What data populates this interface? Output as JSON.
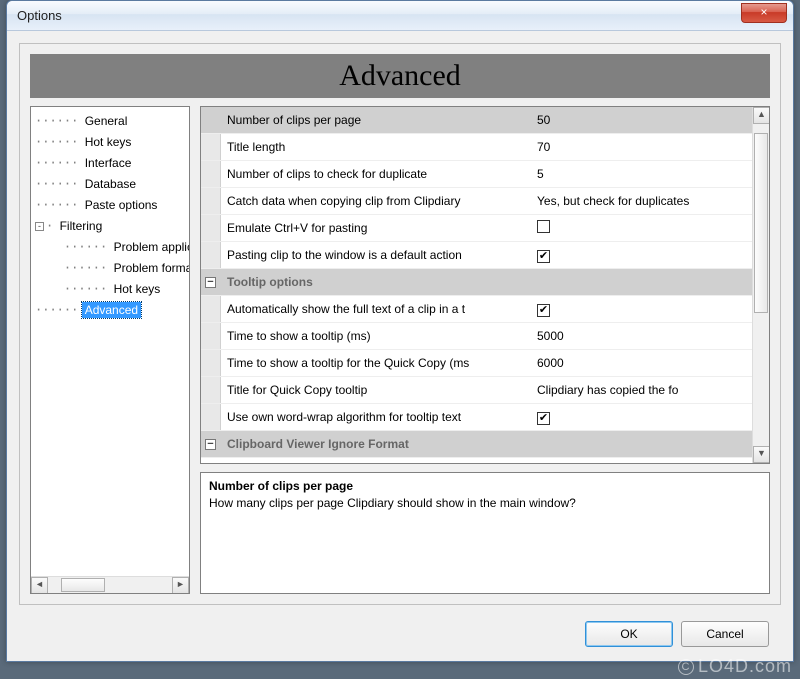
{
  "window": {
    "title": "Options",
    "close_glyph": "×"
  },
  "header": "Advanced",
  "tree": {
    "items": [
      {
        "label": "General",
        "depth": 0
      },
      {
        "label": "Hot keys",
        "depth": 0
      },
      {
        "label": "Interface",
        "depth": 0
      },
      {
        "label": "Database",
        "depth": 0
      },
      {
        "label": "Paste options",
        "depth": 0
      },
      {
        "label": "Filtering",
        "depth": 0,
        "expander": "-"
      },
      {
        "label": "Problem applicat",
        "depth": 1
      },
      {
        "label": "Problem formats",
        "depth": 1
      },
      {
        "label": "Hot keys",
        "depth": 1
      },
      {
        "label": "Advanced",
        "depth": 0,
        "selected": true
      }
    ]
  },
  "grid": {
    "rows": [
      {
        "type": "prop",
        "name": "Number of clips per page",
        "value": "50",
        "selected": true
      },
      {
        "type": "prop",
        "name": "Title length",
        "value": "70"
      },
      {
        "type": "prop",
        "name": "Number of clips to check for duplicate",
        "value": "5"
      },
      {
        "type": "prop",
        "name": "Catch data when copying clip from Clipdiary",
        "value": "Yes, but check for duplicates"
      },
      {
        "type": "prop",
        "name": "Emulate Ctrl+V for pasting",
        "checkbox": true,
        "checked": false
      },
      {
        "type": "prop",
        "name": "Pasting clip to the window is a default action",
        "checkbox": true,
        "checked": true
      },
      {
        "type": "section",
        "name": "Tooltip options"
      },
      {
        "type": "prop",
        "name": "Automatically show the full text of a clip in a t",
        "checkbox": true,
        "checked": true
      },
      {
        "type": "prop",
        "name": "Time to show a tooltip (ms)",
        "value": "5000"
      },
      {
        "type": "prop",
        "name": "Time to show a tooltip for the Quick Copy (ms",
        "value": "6000"
      },
      {
        "type": "prop",
        "name": "Title for Quick Copy tooltip",
        "value": "Clipdiary has copied the fo"
      },
      {
        "type": "prop",
        "name": "Use own word-wrap algorithm for tooltip text",
        "checkbox": true,
        "checked": true
      },
      {
        "type": "section",
        "name": "Clipboard Viewer Ignore Format"
      }
    ]
  },
  "desc": {
    "title": "Number of clips per page",
    "text": "How many clips per page Clipdiary should show in the main window?"
  },
  "buttons": {
    "ok": "OK",
    "cancel": "Cancel"
  },
  "watermark": "LO4D.com"
}
